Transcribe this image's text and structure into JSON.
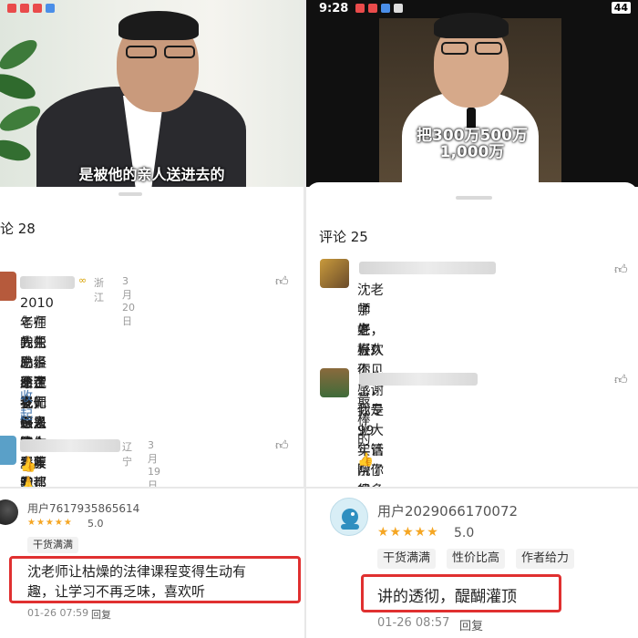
{
  "left_top": {
    "subtitle": "是被他的亲人送进去的",
    "comment_count": "论 28",
    "comments": [
      {
        "badge": "∞",
        "location": "浙江",
        "date": "3月20日",
        "text_lines": [
          "2010年在我先生事业走投无路之际，承蒙沈",
          "老师的帮助，给了我们很多推心置腹的建议，",
          "先生已经不在了，但是这么多年我都铭记在",
          "心，愿沈老师好人一生平安，身体健康，长",
          "命百岁，感恩有你🙏🙏🙏"
        ],
        "collapse": "收起"
      },
      {
        "location": "辽宁",
        "date": "3月19日",
        "text": "👍"
      }
    ]
  },
  "right_top": {
    "status_time": "9:28",
    "status_battery": "44",
    "subtitle_lines": [
      "把300万500万",
      "1,000万"
    ],
    "comment_count": "评论 25",
    "comments": [
      {
        "text_lines": [
          "沈老师好，好久不见了，我是99年管院你的",
          "学生，喜欢你，感谢你专业大实话帮了很多",
          "老板!"
        ]
      },
      {
        "text": "最棒的👍"
      }
    ]
  },
  "left_bottom": {
    "user": "用户7617935865614",
    "rating": "5.0",
    "tags": [
      "干货满满"
    ],
    "text_lines": [
      "沈老师让枯燥的法律课程变得生动有",
      "趣，让学习不再乏味，喜欢听"
    ],
    "datetime": "01-26 07:59",
    "reply": "回复"
  },
  "right_bottom": {
    "user": "用户2029066170072",
    "rating": "5.0",
    "tags": [
      "干货满满",
      "性价比高",
      "作者给力"
    ],
    "text": "讲的透彻，醍醐灌顶",
    "datetime": "01-26 08:57",
    "reply": "回复"
  },
  "colors": {
    "star": "#f5a623",
    "highlight_border": "#e03030",
    "link": "#3a6ea8"
  },
  "icons": [
    "thumbs-up-icon",
    "star-icon",
    "avatar-icon"
  ]
}
